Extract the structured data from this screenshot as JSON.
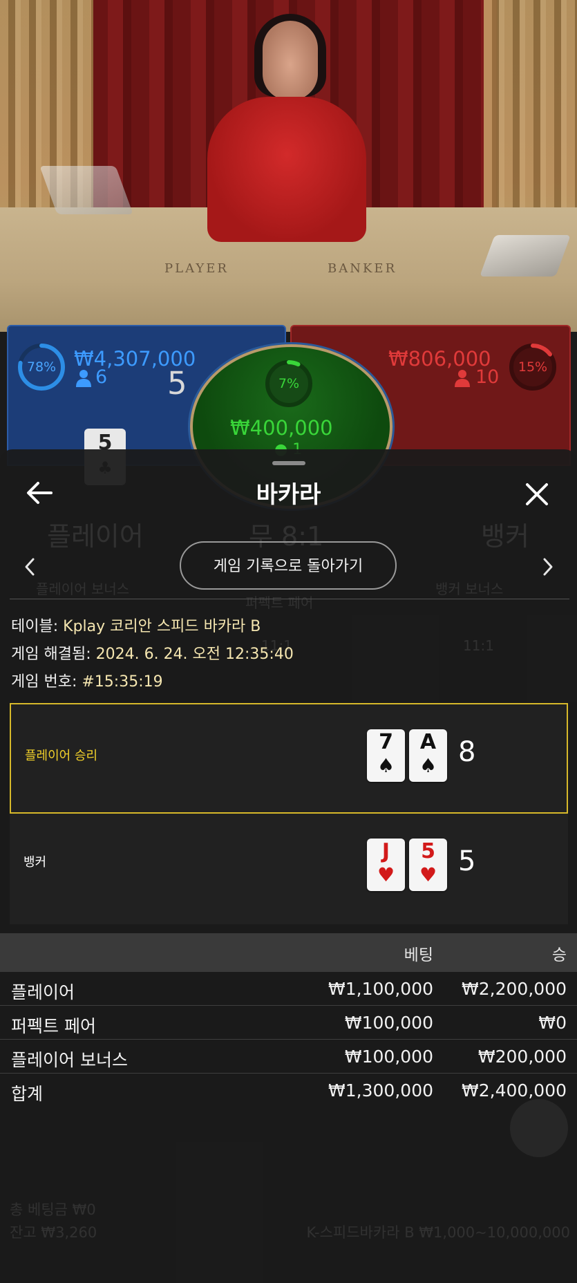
{
  "video": {
    "felt_labels": {
      "player": "PLAYER",
      "banker": "BANKER"
    }
  },
  "bet_panels": {
    "player": {
      "percent": "78%",
      "amount": "₩4,307,000",
      "count": "6",
      "score": "5",
      "peek_card": "5"
    },
    "tie": {
      "percent": "7%",
      "amount": "₩400,000",
      "count": "1"
    },
    "banker": {
      "percent": "15%",
      "amount": "₩806,000",
      "count": "10"
    }
  },
  "background_ghost": {
    "player_label": "플레이어",
    "tie_label": "무 8:1",
    "banker_label": "뱅커",
    "player_bonus": "플레이어 보너스",
    "perfect_pair": "퍼펙트 페어",
    "banker_bonus": "뱅커 보너스",
    "player_pair": "11:1",
    "banker_pair": "11:1",
    "total_bet": "총 베팅금 ₩0",
    "balance": "잔고 ₩3,260",
    "table_limits": "K-스피드바카라 B ₩1,000~10,000,000"
  },
  "modal": {
    "title": "바카라",
    "back_to_history": "게임 기록으로 돌아가기",
    "info": {
      "table_label": "테이블:",
      "table_value": "Kplay 코리안 스피드 바카라 B",
      "settled_label": "게임 해결됨:",
      "settled_value": "2024. 6. 24. 오전 12:35:40",
      "round_label": "게임 번호:",
      "round_value": "#15:35:19"
    },
    "results": {
      "player": {
        "label": "플레이어 승리",
        "cards": [
          {
            "rank": "7",
            "suit": "♠"
          },
          {
            "rank": "A",
            "suit": "♠"
          }
        ],
        "score": "8"
      },
      "banker": {
        "label": "뱅커",
        "cards": [
          {
            "rank": "J",
            "suit": "♥"
          },
          {
            "rank": "5",
            "suit": "♥"
          }
        ],
        "score": "5"
      }
    },
    "bets_table": {
      "headers": {
        "bet": "베팅",
        "win": "승"
      },
      "rows": [
        {
          "name": "플레이어",
          "bet": "₩1,100,000",
          "win": "₩2,200,000"
        },
        {
          "name": "퍼펙트 페어",
          "bet": "₩100,000",
          "win": "₩0"
        },
        {
          "name": "플레이어 보너스",
          "bet": "₩100,000",
          "win": "₩200,000"
        }
      ],
      "total": {
        "name": "합계",
        "bet": "₩1,300,000",
        "win": "₩2,400,000"
      }
    }
  },
  "colors": {
    "player_blue": "#1c3d78",
    "banker_red": "#701818",
    "tie_green": "#39d639",
    "winner_border": "#d7b92a",
    "winner_label": "#f2d12a",
    "heart_red": "#d21a1a"
  },
  "icons": {
    "back": "arrow-left-icon",
    "close": "close-icon",
    "prev": "chevron-left-icon",
    "next": "chevron-right-icon",
    "person": "person-icon"
  }
}
